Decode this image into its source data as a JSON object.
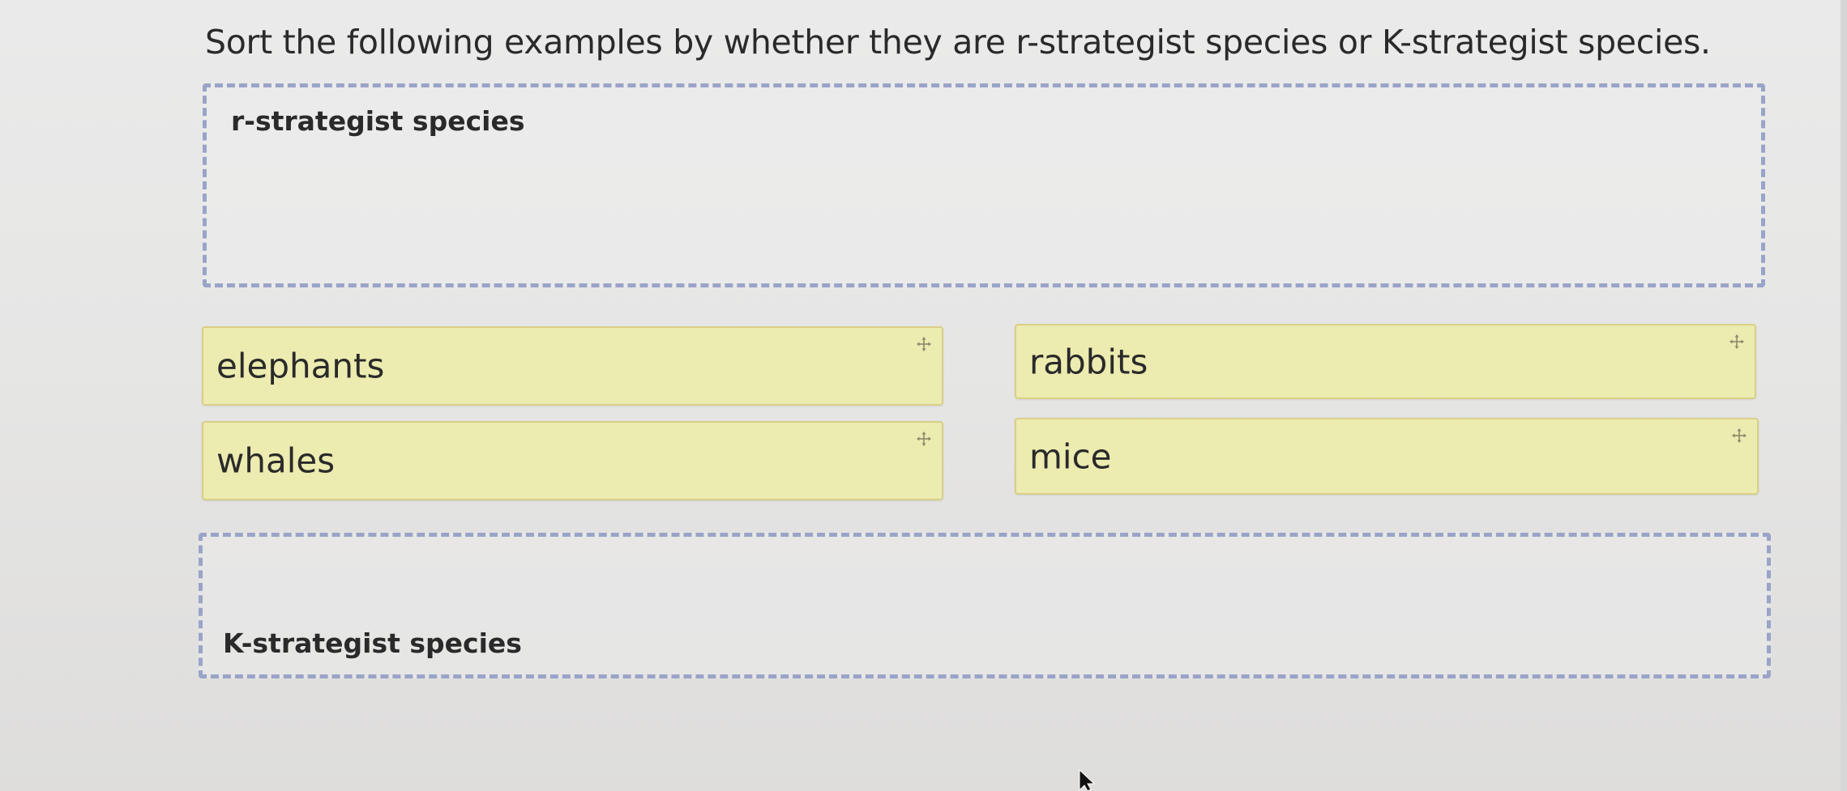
{
  "question": {
    "text": "Sort the following examples by whether they are r-strategist species or K-strategist species."
  },
  "dropzones": {
    "r_strategist": {
      "label": "r-strategist species"
    },
    "k_strategist": {
      "label": "K-strategist species"
    }
  },
  "items": [
    {
      "label": "elephants",
      "icon": "move-icon"
    },
    {
      "label": "rabbits",
      "icon": "move-icon"
    },
    {
      "label": "whales",
      "icon": "move-icon"
    },
    {
      "label": "mice",
      "icon": "move-icon"
    }
  ],
  "colors": {
    "chip_background": "#ecebb0",
    "chip_border": "#d9cf86",
    "dropzone_border": "#9aa4c8",
    "text": "#2a2a2a"
  }
}
